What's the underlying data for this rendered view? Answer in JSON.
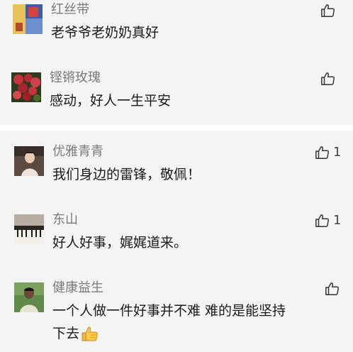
{
  "comments_top": [
    {
      "name": "红丝带",
      "text": "老爷爷老奶奶真好",
      "likes": "",
      "avatar": "red-ribbon-avatar"
    },
    {
      "name": "铿锵玫瑰",
      "text": "感动，好人一生平安",
      "likes": "",
      "avatar": "roses-avatar"
    }
  ],
  "comments_bottom": [
    {
      "name": "优雅青青",
      "text": "我们身边的雷锋，敬佩！",
      "likes": "1",
      "avatar": "woman-avatar"
    },
    {
      "name": "东山",
      "text": "好人好事，娓娓道来。",
      "likes": "1",
      "avatar": "piano-avatar"
    },
    {
      "name": "健康益生",
      "text_line1": "一个人做一件好事并不难 难的是能坚持",
      "text_line2": "下去",
      "likes": "",
      "avatar": "man-avatar",
      "emoji": "thumbs-up-emoji"
    }
  ],
  "colors": {
    "like_icon": "#333333",
    "name": "#7a7a7a",
    "text": "#1a1a1a",
    "background": "#f4f4f4",
    "separator": "#ffffff"
  }
}
